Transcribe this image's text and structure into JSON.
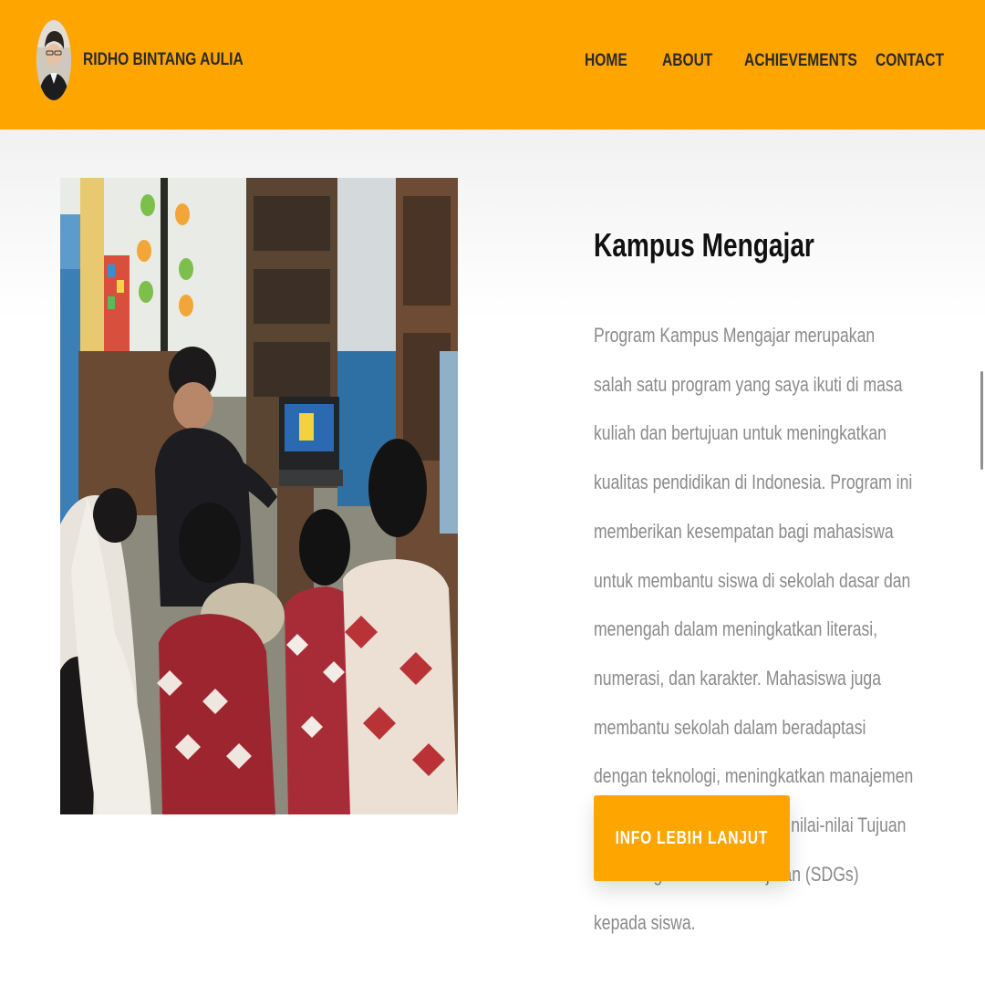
{
  "header": {
    "brand": "RIDHO BINTANG AULIA",
    "nav": {
      "home": "HOME",
      "about": "ABOUT",
      "achievements": "ACHIEVEMENTS",
      "contact": "CONTACT"
    }
  },
  "main": {
    "title": "Kampus Mengajar",
    "description": "Program Kampus Mengajar merupakan salah satu program yang saya ikuti di masa kuliah dan bertujuan untuk meningkatkan kualitas pendidikan di Indonesia. Program ini memberikan kesempatan bagi mahasiswa untuk membantu siswa di sekolah dasar dan menengah dalam meningkatkan literasi, numerasi, dan karakter. Mahasiswa juga membantu sekolah dalam beradaptasi dengan teknologi, meningkatkan manajemen sekolah, dan menanamkan nilai-nilai Tujuan Pembangunan Berkelanjutan (SDGs) kepada siswa.",
    "cta_label": "INFO LEBIH LANJUT"
  },
  "colors": {
    "accent": "#ffa500",
    "nav_text": "#2a2a2a",
    "title_text": "#111111",
    "body_text": "#8a8a8a",
    "button_text": "#ffffff"
  }
}
